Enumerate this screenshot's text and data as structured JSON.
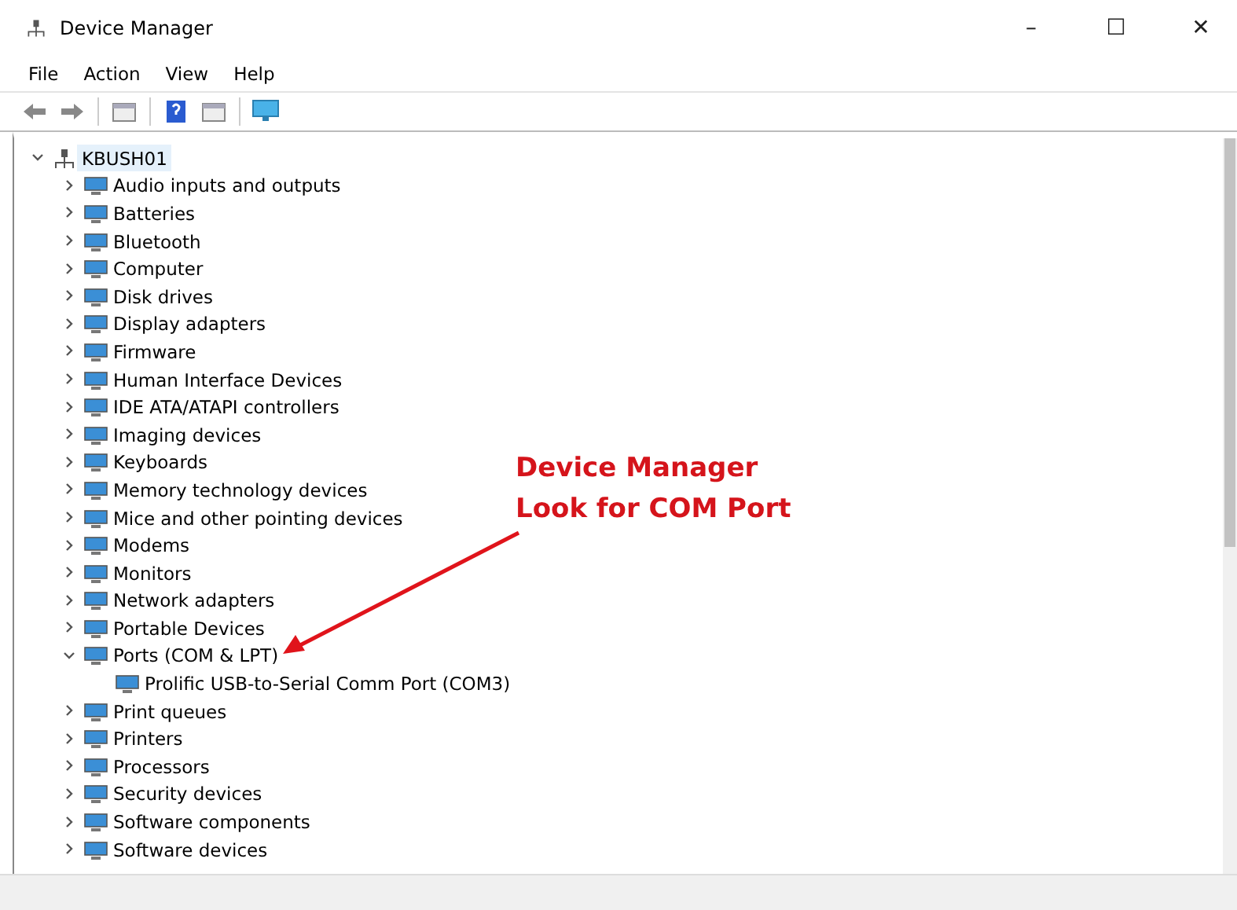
{
  "window": {
    "title": "Device Manager",
    "controls": [
      "–",
      "☐",
      "✕"
    ]
  },
  "menu": [
    "File",
    "Action",
    "View",
    "Help"
  ],
  "toolbar": [
    {
      "kind": "back"
    },
    {
      "kind": "forward"
    },
    {
      "kind": "sep"
    },
    {
      "kind": "panel"
    },
    {
      "kind": "sep"
    },
    {
      "kind": "help"
    },
    {
      "kind": "panel"
    },
    {
      "kind": "sep"
    },
    {
      "kind": "monitor"
    }
  ],
  "tree": {
    "label": "KBUSH01",
    "expanded": true,
    "selected": true,
    "children": [
      {
        "label": "Audio inputs and outputs",
        "expanded": false,
        "selected": false
      },
      {
        "label": "Batteries",
        "expanded": false,
        "selected": false
      },
      {
        "label": "Bluetooth",
        "expanded": false,
        "selected": false
      },
      {
        "label": "Computer",
        "expanded": false,
        "selected": false
      },
      {
        "label": "Disk drives",
        "expanded": false,
        "selected": false
      },
      {
        "label": "Display adapters",
        "expanded": false,
        "selected": false
      },
      {
        "label": "Firmware",
        "expanded": false,
        "selected": false
      },
      {
        "label": "Human Interface Devices",
        "expanded": false,
        "selected": false
      },
      {
        "label": "IDE ATA/ATAPI controllers",
        "expanded": false,
        "selected": false
      },
      {
        "label": "Imaging devices",
        "expanded": false,
        "selected": false
      },
      {
        "label": "Keyboards",
        "expanded": false,
        "selected": false
      },
      {
        "label": "Memory technology devices",
        "expanded": false,
        "selected": false
      },
      {
        "label": "Mice and other pointing devices",
        "expanded": false,
        "selected": false
      },
      {
        "label": "Modems",
        "expanded": false,
        "selected": false
      },
      {
        "label": "Monitors",
        "expanded": false,
        "selected": false
      },
      {
        "label": "Network adapters",
        "expanded": false,
        "selected": false
      },
      {
        "label": "Portable Devices",
        "expanded": false,
        "selected": false
      },
      {
        "label": "Ports (COM & LPT)",
        "expanded": true,
        "selected": false,
        "children": [
          {
            "label": "Prolific USB-to-Serial Comm Port (COM3)",
            "selected": false
          }
        ]
      },
      {
        "label": "Print queues",
        "expanded": false,
        "selected": false
      },
      {
        "label": "Printers",
        "expanded": false,
        "selected": false
      },
      {
        "label": "Processors",
        "expanded": false,
        "selected": false
      },
      {
        "label": "Security devices",
        "expanded": false,
        "selected": false
      },
      {
        "label": "Software components",
        "expanded": false,
        "selected": false
      },
      {
        "label": "Software devices",
        "expanded": false,
        "selected": false
      }
    ]
  },
  "annotation": {
    "lines": [
      "Device Manager",
      "Look for COM Port"
    ]
  }
}
